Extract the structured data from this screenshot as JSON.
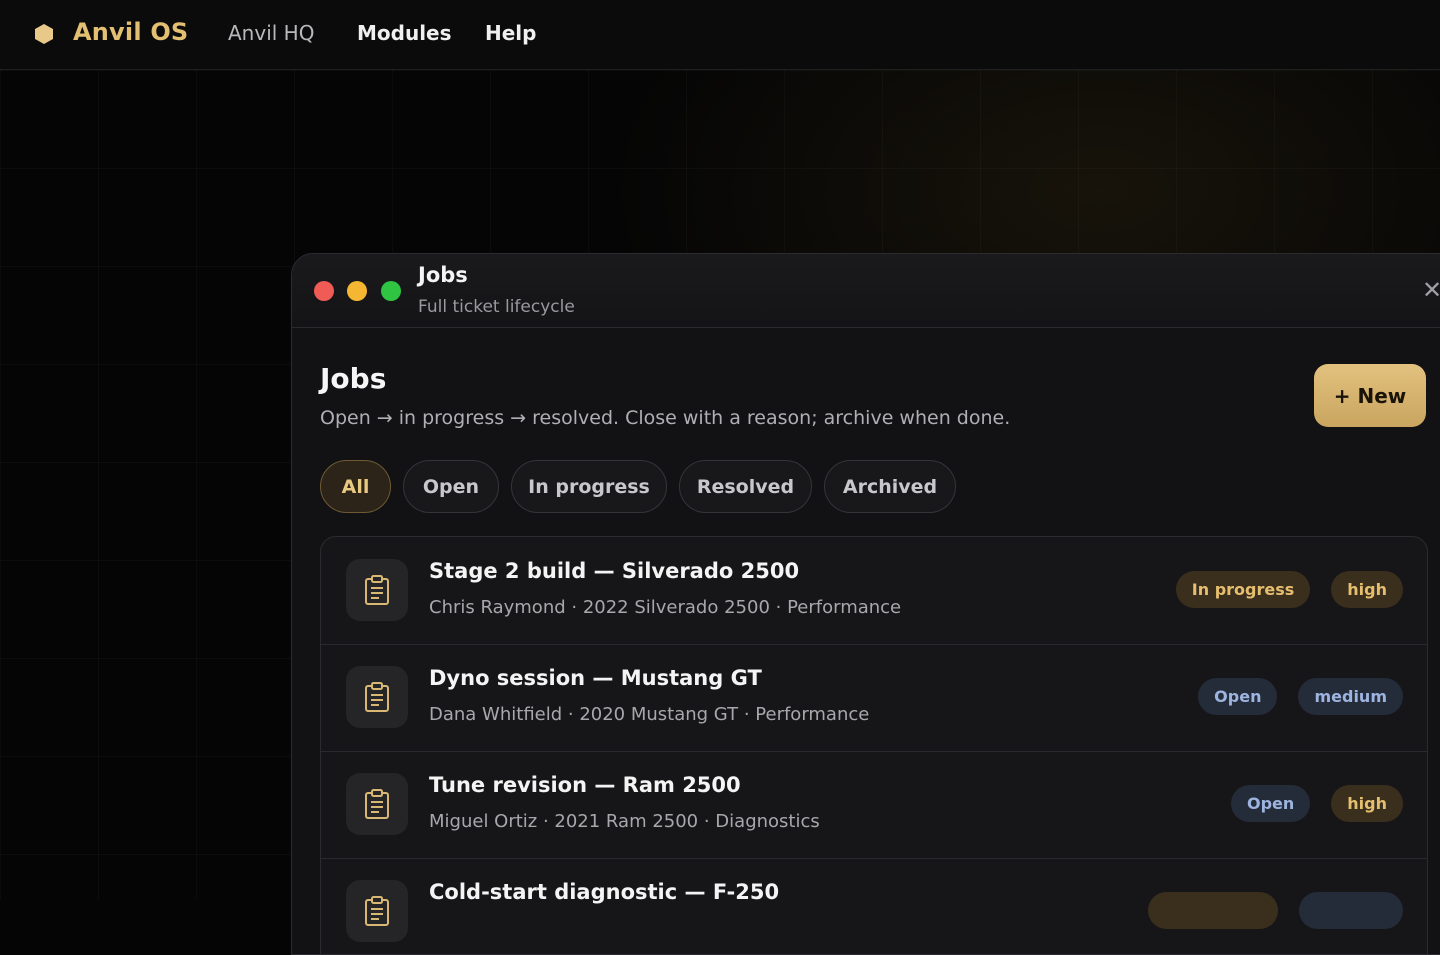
{
  "topbar": {
    "brand": "Anvil OS",
    "nav": [
      "Anvil HQ",
      "Modules",
      "Help"
    ]
  },
  "window": {
    "title": "Jobs",
    "subtitle": "Full ticket lifecycle",
    "close_label": "✕"
  },
  "page": {
    "title": "Jobs",
    "description": "Open → in progress → resolved. Close with a reason; archive when done.",
    "new_button": "+ New"
  },
  "filters": [
    "All",
    "Open",
    "In progress",
    "Resolved",
    "Archived"
  ],
  "jobs": [
    {
      "title": "Stage 2 build — Silverado 2500",
      "meta": "Chris Raymond · 2022 Silverado 2500 · Performance",
      "status": "In progress",
      "priority": "high"
    },
    {
      "title": "Dyno session — Mustang GT",
      "meta": "Dana Whitfield · 2020 Mustang GT · Performance",
      "status": "Open",
      "priority": "medium"
    },
    {
      "title": "Tune revision — Ram 2500",
      "meta": "Miguel Ortiz · 2021 Ram 2500 · Diagnostics",
      "status": "Open",
      "priority": "high"
    },
    {
      "title": "Cold-start diagnostic — F-250",
      "meta": "",
      "status": "",
      "priority": ""
    }
  ],
  "colors": {
    "accent": "#e3bf72",
    "background": "#050505",
    "panel": "#121214",
    "status_progress": "#e6be6f",
    "status_open": "#9db4e0"
  },
  "icons": [
    "hexagon-logo-icon",
    "clipboard-icon",
    "close-icon"
  ]
}
